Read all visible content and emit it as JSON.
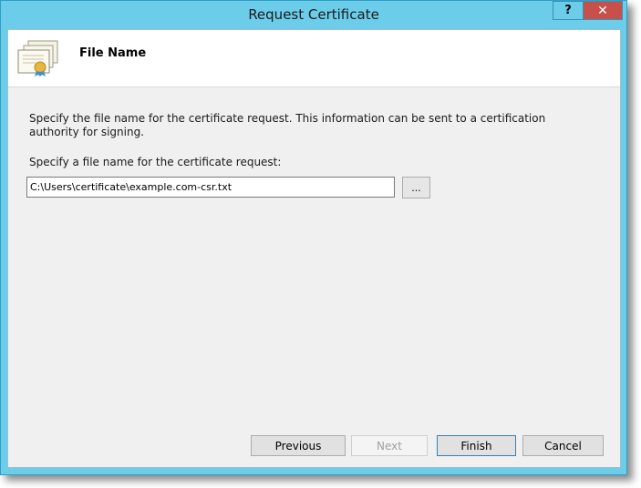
{
  "window": {
    "title": "Request Certificate",
    "help_label": "?",
    "close_label": "✕"
  },
  "header": {
    "title": "File Name",
    "icon": "certificate-icon"
  },
  "body": {
    "description": "Specify the file name for the certificate request. This information can be sent to a certification authority for signing.",
    "file_label": "Specify a file name for the certificate request:",
    "file_value": "C:\\Users\\certificate\\example.com-csr.txt",
    "browse_label": "..."
  },
  "footer": {
    "previous_label": "Previous",
    "next_label": "Next",
    "finish_label": "Finish",
    "cancel_label": "Cancel"
  }
}
